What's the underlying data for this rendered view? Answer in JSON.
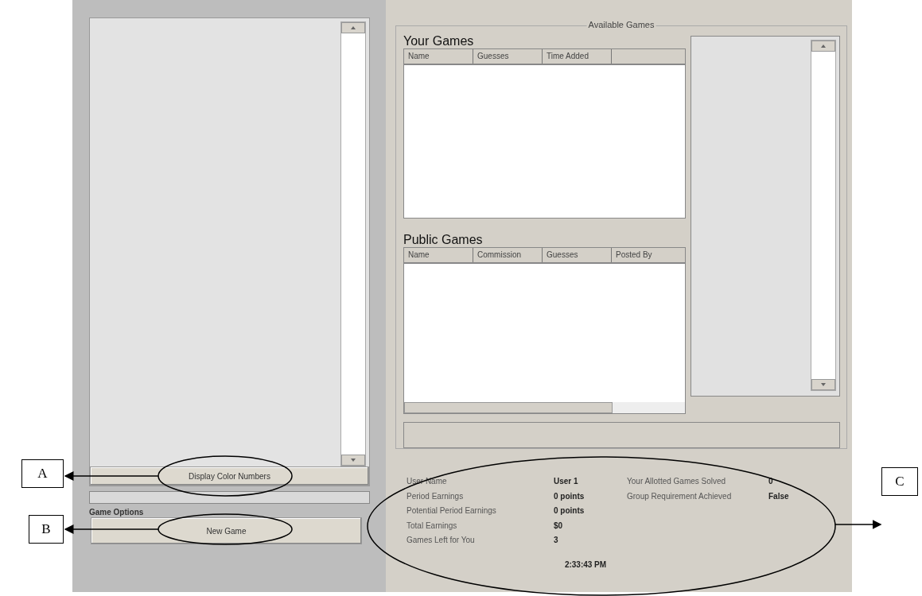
{
  "left_panel": {
    "display_button": "Display Color Numbers",
    "game_options": {
      "title": "Game Options",
      "button": "New Game"
    }
  },
  "available_games": {
    "title": "Available Games",
    "your_games": {
      "title": "Your Games",
      "columns": [
        "Name",
        "Guesses",
        "Time Added"
      ]
    },
    "public_games": {
      "title": "Public Games",
      "columns": [
        "Name",
        "Commission",
        "Guesses",
        "Posted By"
      ]
    }
  },
  "status": {
    "left": [
      {
        "label": "User Name",
        "value": "User 1"
      },
      {
        "label": "Period Earnings",
        "value": "0 points"
      },
      {
        "label": "Potential Period Earnings",
        "value": "0 points"
      },
      {
        "label": "Total Earnings",
        "value": "$0"
      },
      {
        "label": "Games Left for You",
        "value": "3"
      }
    ],
    "right": [
      {
        "label": "Your Allotted Games Solved",
        "value": "0"
      },
      {
        "label": "Group Requirement Achieved",
        "value": "False"
      }
    ],
    "time": "2:33:43 PM"
  },
  "annotations": [
    {
      "label": "A"
    },
    {
      "label": "B"
    },
    {
      "label": "C"
    }
  ]
}
